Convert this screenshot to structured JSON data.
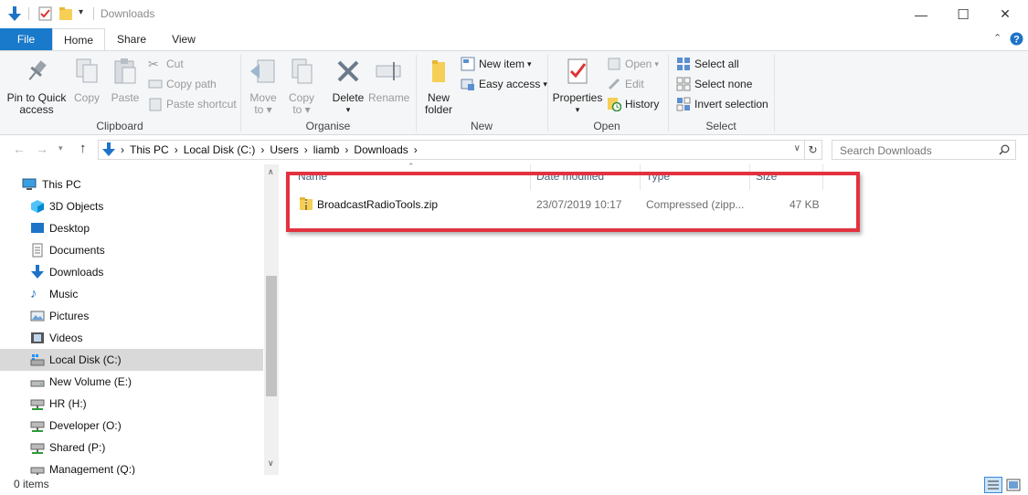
{
  "window": {
    "title": "Downloads",
    "minimize_glyph": "—",
    "maximize_glyph": "☐",
    "close_glyph": "✕"
  },
  "ribbon_tabs": [
    {
      "label": "File"
    },
    {
      "label": "Home"
    },
    {
      "label": "Share"
    },
    {
      "label": "View"
    }
  ],
  "ribbon": {
    "clipboard": {
      "pin_line1": "Pin to Quick",
      "pin_line2": "access",
      "copy": "Copy",
      "paste": "Paste",
      "cut": "Cut",
      "copy_path": "Copy path",
      "paste_shortcut": "Paste shortcut",
      "label": "Clipboard"
    },
    "organise": {
      "move_line1": "Move",
      "move_line2": "to",
      "copy_line1": "Copy",
      "copy_line2": "to",
      "delete": "Delete",
      "rename": "Rename",
      "label": "Organise"
    },
    "new": {
      "new_folder_line1": "New",
      "new_folder_line2": "folder",
      "new_item": "New item",
      "easy_access": "Easy access",
      "label": "New"
    },
    "open": {
      "properties": "Properties",
      "open": "Open",
      "edit": "Edit",
      "history": "History",
      "label": "Open"
    },
    "select": {
      "select_all": "Select all",
      "select_none": "Select none",
      "invert_selection": "Invert selection",
      "label": "Select"
    }
  },
  "address": {
    "crumbs": [
      "This PC",
      "Local Disk (C:)",
      "Users",
      "liamb",
      "Downloads"
    ],
    "search_placeholder": "Search Downloads"
  },
  "nav_pane": {
    "items": [
      {
        "label": "This PC",
        "icon": "computer-icon"
      },
      {
        "label": "3D Objects",
        "icon": "3d-objects-icon"
      },
      {
        "label": "Desktop",
        "icon": "desktop-icon"
      },
      {
        "label": "Documents",
        "icon": "documents-icon"
      },
      {
        "label": "Downloads",
        "icon": "downloads-icon"
      },
      {
        "label": "Music",
        "icon": "music-icon"
      },
      {
        "label": "Pictures",
        "icon": "pictures-icon"
      },
      {
        "label": "Videos",
        "icon": "videos-icon"
      },
      {
        "label": "Local Disk (C:)",
        "icon": "windows-drive-icon",
        "selected": true
      },
      {
        "label": "New Volume (E:)",
        "icon": "drive-icon"
      },
      {
        "label": "HR (H:)",
        "icon": "network-drive-icon"
      },
      {
        "label": "Developer (O:)",
        "icon": "network-drive-icon"
      },
      {
        "label": "Shared (P:)",
        "icon": "network-drive-icon"
      },
      {
        "label": "Management (Q:)",
        "icon": "network-drive-icon"
      }
    ]
  },
  "file_list": {
    "columns": [
      "Name",
      "Date modified",
      "Type",
      "Size"
    ],
    "rows": [
      {
        "name": "BroadcastRadioTools.zip",
        "date": "23/07/2019 10:17",
        "type": "Compressed (zipp...",
        "size": "47 KB",
        "icon": "zip-folder-icon"
      }
    ]
  },
  "status_bar": {
    "items": "0 items"
  },
  "colors": {
    "accent": "#1979ca",
    "highlight": "#e2323f",
    "selected_nav": "#d9d9d9"
  }
}
